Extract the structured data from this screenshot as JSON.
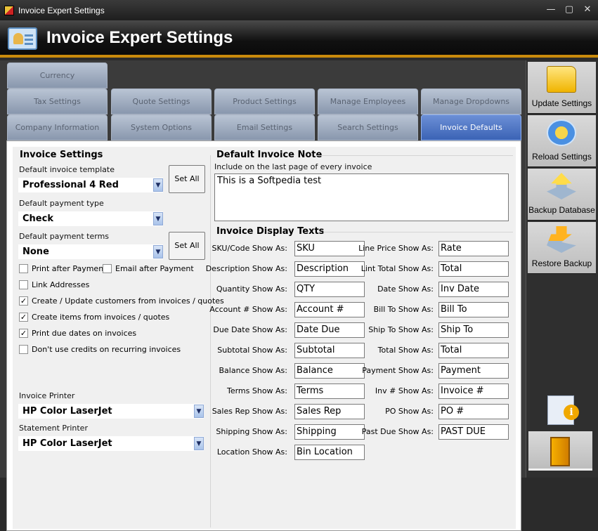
{
  "window": {
    "title": "Invoice Expert Settings",
    "minimize": "—",
    "maximize": "▢",
    "close": "✕"
  },
  "header": {
    "title": "Invoice Expert Settings"
  },
  "tabs": {
    "row1": [
      "Currency"
    ],
    "row2": [
      "Tax Settings",
      "Quote Settings",
      "Product Settings",
      "Manage Employees",
      "Manage Dropdowns"
    ],
    "row3": [
      "Company Information",
      "System Options",
      "Email Settings",
      "Search Settings",
      "Invoice Defaults"
    ],
    "active": "Invoice Defaults"
  },
  "invoice_settings": {
    "title": "Invoice Settings",
    "template_label": "Default invoice template",
    "template_value": "Professional 4 Red",
    "payment_type_label": "Default payment type",
    "payment_type_value": "Check",
    "payment_terms_label": "Default payment terms",
    "payment_terms_value": "None",
    "set_all_label": "Set All",
    "checkboxes": [
      {
        "label": "Print after Payment",
        "checked": false
      },
      {
        "label": "Email after Payment",
        "checked": false
      },
      {
        "label": "Link Addresses",
        "checked": false
      },
      {
        "label": "Create / Update customers from invoices /  quotes",
        "checked": true
      },
      {
        "label": "Create items from invoices /  quotes",
        "checked": true
      },
      {
        "label": "Print due dates on invoices",
        "checked": true
      },
      {
        "label": "Don't use credits on recurring invoices",
        "checked": false
      }
    ],
    "invoice_printer_label": "Invoice Printer",
    "invoice_printer_value": "HP Color LaserJet",
    "statement_printer_label": "Statement Printer",
    "statement_printer_value": "HP Color LaserJet"
  },
  "note": {
    "title": "Default Invoice Note",
    "hint": "Include on the last page of every invoice",
    "value": "This is a Softpedia test"
  },
  "display_texts": {
    "title": "Invoice Display Texts",
    "left": [
      {
        "label": "SKU/Code Show As:",
        "value": "SKU"
      },
      {
        "label": "Description Show As:",
        "value": "Description"
      },
      {
        "label": "Quantity Show As:",
        "value": "QTY"
      },
      {
        "label": "Account # Show As:",
        "value": "Account #"
      },
      {
        "label": "Due Date Show As:",
        "value": "Date Due"
      },
      {
        "label": "Subtotal Show As:",
        "value": "Subtotal"
      },
      {
        "label": "Balance Show As:",
        "value": "Balance"
      },
      {
        "label": "Terms Show As:",
        "value": "Terms"
      },
      {
        "label": "Sales Rep Show As:",
        "value": "Sales Rep"
      },
      {
        "label": "Shipping Show As:",
        "value": "Shipping"
      },
      {
        "label": "Location Show As:",
        "value": "Bin Location"
      }
    ],
    "right": [
      {
        "label": "Line Price Show As:",
        "value": "Rate"
      },
      {
        "label": "Lint Total Show As:",
        "value": "Total"
      },
      {
        "label": "Date Show As:",
        "value": "Inv Date"
      },
      {
        "label": "Bill To Show As:",
        "value": "Bill To"
      },
      {
        "label": "Ship To Show As:",
        "value": "Ship To"
      },
      {
        "label": "Total Show As:",
        "value": "Total"
      },
      {
        "label": "Payment Show As:",
        "value": "Payment"
      },
      {
        "label": "Inv # Show As:",
        "value": "Invoice #"
      },
      {
        "label": "PO Show As:",
        "value": "PO #"
      },
      {
        "label": "Past Due Show As:",
        "value": "PAST DUE"
      }
    ]
  },
  "sidebar": {
    "update": "Update Settings",
    "reload": "Reload Settings",
    "backup": "Backup Database",
    "restore": "Restore Backup",
    "info_glyph": "i"
  },
  "icons": {
    "dropdown_arrow": "▼",
    "check": "✓"
  }
}
